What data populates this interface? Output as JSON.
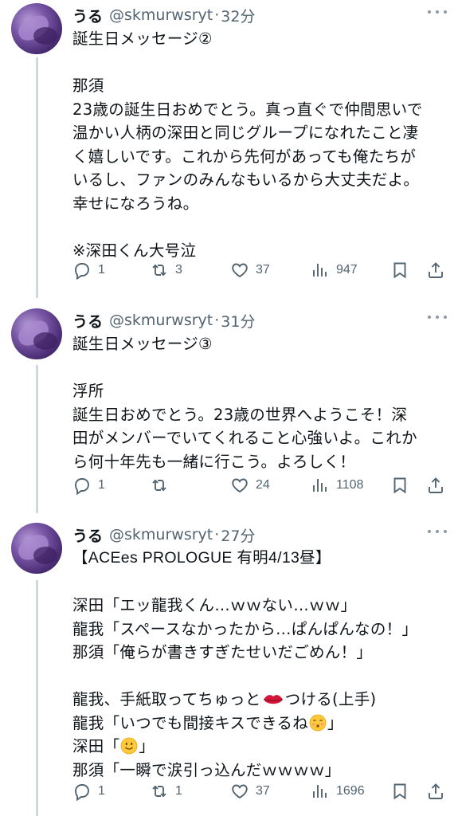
{
  "tweets": [
    {
      "name": "うる",
      "handle": "@skmurwsryt",
      "dot": "·",
      "time": "32分",
      "title": "誕生日メッセージ②",
      "lines": [
        "",
        "那須",
        "23歳の誕生日おめでとう。真っ直ぐで仲間思いで",
        "温かい人柄の深田と同じグループになれたこと凄",
        "く嬉しいです。これから先何があっても俺たちが",
        "いるし、ファンのみんなもいるから大丈夫だよ。",
        "幸せになろうね。",
        "",
        "※深田くん大号泣"
      ],
      "replies": "1",
      "retweets": "3",
      "likes": "37",
      "views": "947"
    },
    {
      "name": "うる",
      "handle": "@skmurwsryt",
      "dot": "·",
      "time": "31分",
      "title": "誕生日メッセージ③",
      "lines": [
        "",
        "浮所",
        "誕生日おめでとう。23歳の世界へようこそ！深",
        "田がメンバーでいてくれること心強いよ。これか",
        "ら何十年先も一緒に行こう。よろしく！"
      ],
      "replies": "1",
      "retweets": "",
      "likes": "24",
      "views": "1108"
    },
    {
      "name": "うる",
      "handle": "@skmurwsryt",
      "dot": "·",
      "time": "27分",
      "title": "【ACEes PROLOGUE 有明4/13昼】",
      "lines": [
        "",
        "深田「エッ龍我くん…ｗｗない…ｗｗ」",
        "龍我「スペースなかったから…ぱんぱんなの！」",
        "那須「俺らが書きすぎたせいだごめん！」",
        "",
        "龍我、手紙取ってちゅっと",
        "つける(上手)",
        "龍我「いつでも間接キスできるね",
        "」",
        "深田「",
        "」",
        "那須「一瞬で涙引っ込んだｗｗｗｗ」"
      ],
      "replies": "1",
      "retweets": "1",
      "likes": "37",
      "views": "1696"
    }
  ],
  "icons": {
    "reply": "reply-icon",
    "retweet": "retweet-icon",
    "like": "heart-icon",
    "views": "views-icon",
    "bookmark": "bookmark-icon",
    "share": "share-icon",
    "more": "more-icon"
  },
  "colors": {
    "text": "#0f1419",
    "muted": "#536471",
    "thread_line": "#cfd9de"
  }
}
